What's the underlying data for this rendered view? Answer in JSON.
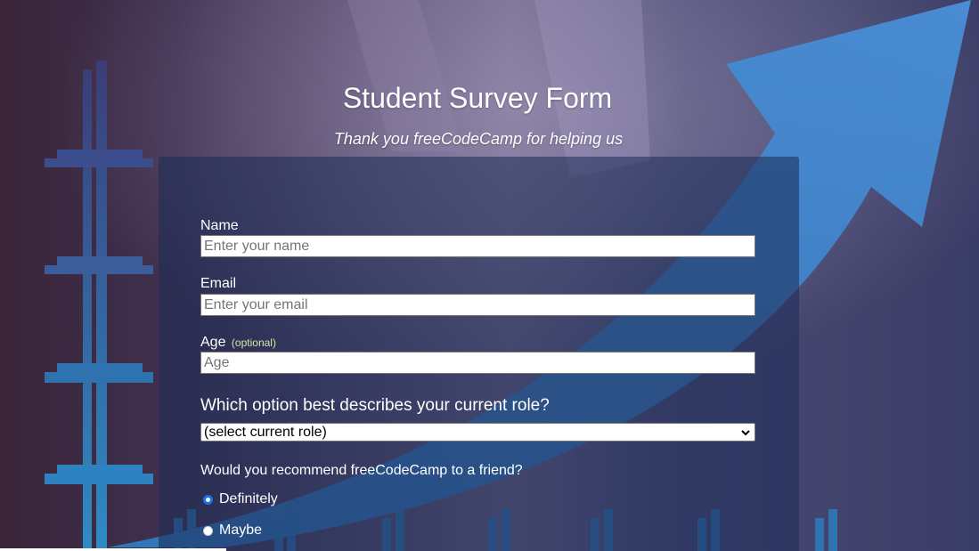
{
  "header": {
    "title": "Student Survey Form",
    "subtitle": "Thank you freeCodeCamp for helping us"
  },
  "form": {
    "name": {
      "label": "Name",
      "placeholder": "Enter your name"
    },
    "email": {
      "label": "Email",
      "placeholder": "Enter your email"
    },
    "age": {
      "label": "Age",
      "optional": "(optional)",
      "placeholder": "Age"
    },
    "role": {
      "question": "Which option best describes your current role?",
      "selected": "(select current role)"
    },
    "recommend": {
      "question": "Would you recommend freeCodeCamp to a friend?",
      "options": [
        {
          "label": "Definitely",
          "checked": true
        },
        {
          "label": "Maybe",
          "checked": false
        }
      ]
    }
  },
  "icons": {
    "dropdown": "chevron-down-icon"
  },
  "colors": {
    "accent": "#1a73e8",
    "optional_text": "#d9e89b",
    "arrow": "#3b8ad6"
  }
}
